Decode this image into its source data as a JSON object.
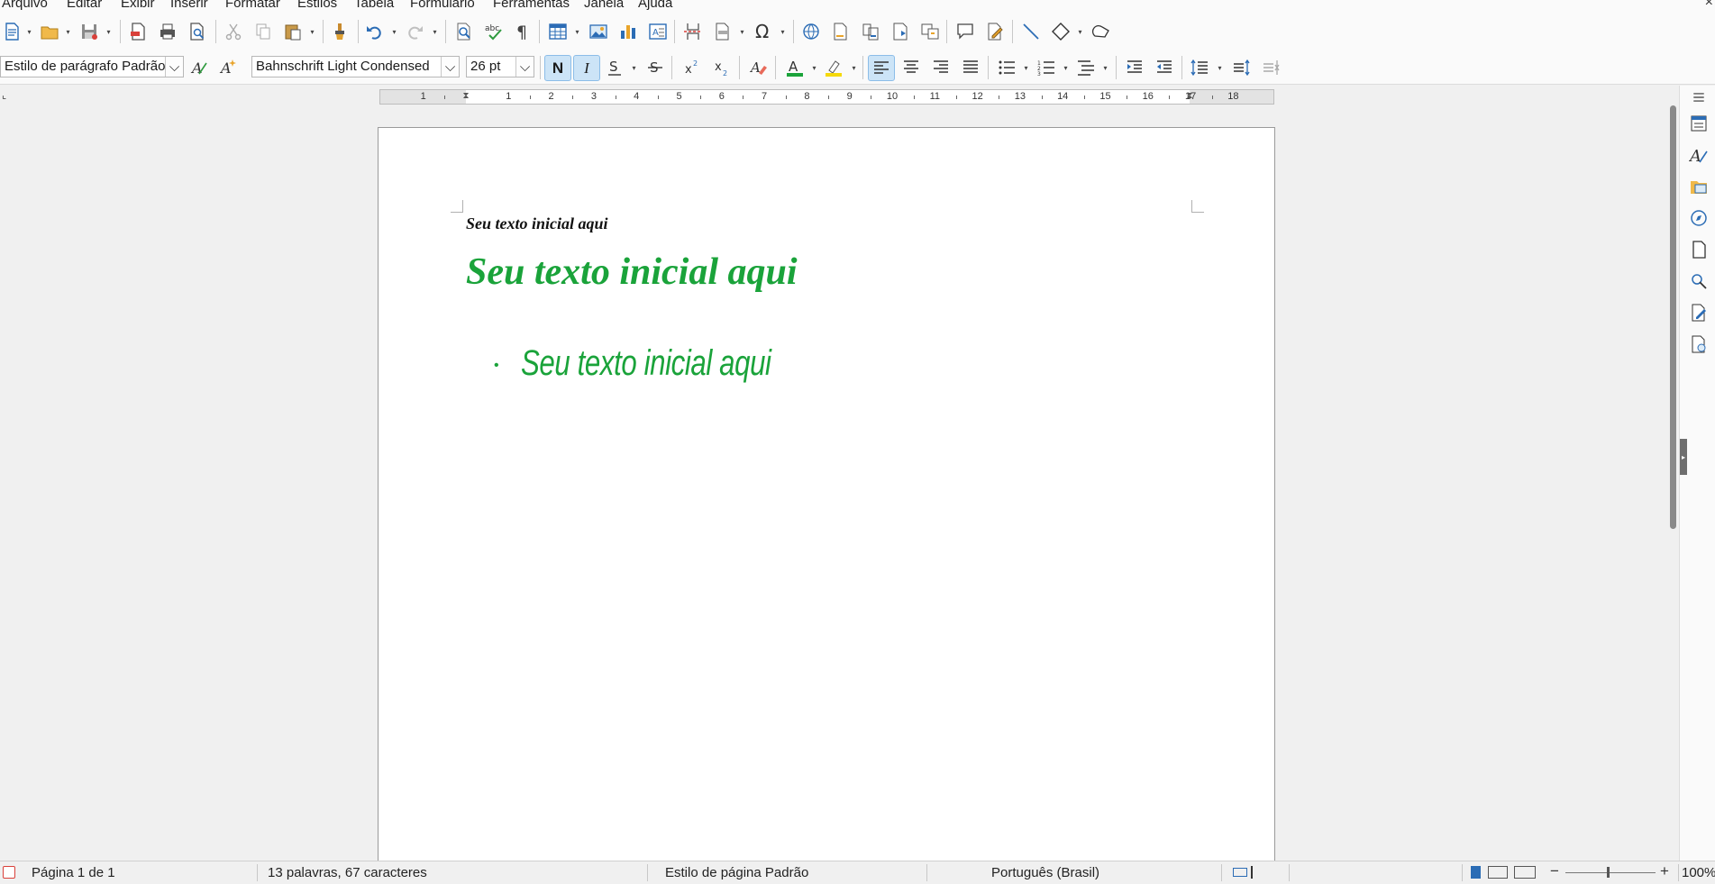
{
  "menu": {
    "items": [
      "Arquivo",
      "Editar",
      "Exibir",
      "Inserir",
      "Formatar",
      "Estilos",
      "Tabela",
      "Formulário",
      "Ferramentas",
      "Janela",
      "Ajuda"
    ],
    "close_glyph": "×"
  },
  "formatting": {
    "paragraph_style": "Estilo de parágrafo Padrão",
    "font_name": "Bahnschrift Light Condensed",
    "font_size": "26 pt",
    "bold_label": "N",
    "italic_label": "I",
    "font_color": "#1aa33a",
    "highlight_color": "#f5d90a"
  },
  "ruler": {
    "labels": [
      "1",
      "1",
      "2",
      "3",
      "4",
      "5",
      "6",
      "7",
      "8",
      "9",
      "10",
      "11",
      "12",
      "13",
      "14",
      "15",
      "16",
      "17",
      "18"
    ]
  },
  "document": {
    "line1": "Seu texto inicial aqui",
    "line2": "Seu texto inicial aqui",
    "list_item": "Seu texto inicial aqui",
    "bullet": "•",
    "text_color": "#1aa33a"
  },
  "statusbar": {
    "page": "Página 1 de 1",
    "words": "13 palavras, 67 caracteres",
    "page_style": "Estilo de página Padrão",
    "language": "Português (Brasil)",
    "zoom": "100%"
  }
}
